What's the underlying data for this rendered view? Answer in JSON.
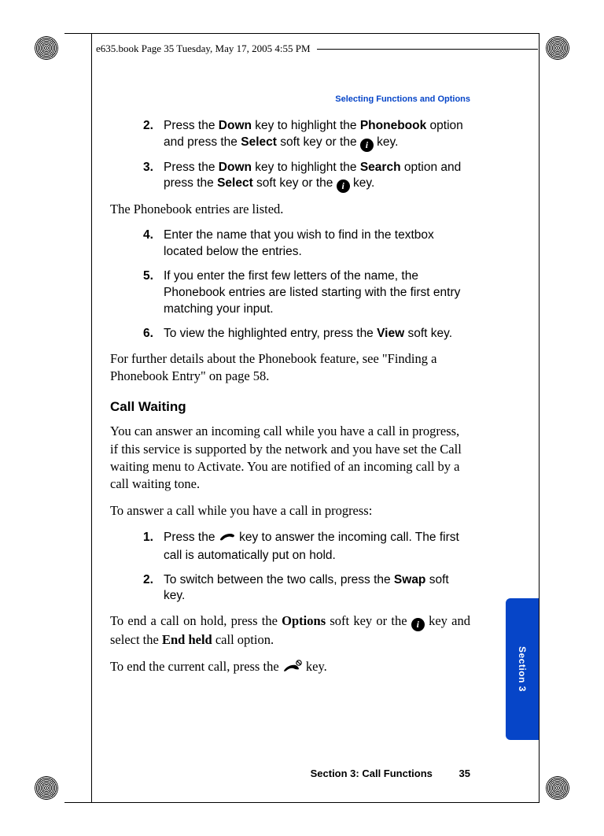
{
  "header": {
    "running": "e635.book  Page 35  Tuesday, May 17, 2005  4:55 PM"
  },
  "section_label": "Selecting Functions and Options",
  "steps_a": {
    "s2_num": "2.",
    "s2_a": "Press the ",
    "s2_b": "Down",
    "s2_c": " key to highlight the ",
    "s2_d": "Phonebook",
    "s2_e": " option and press the ",
    "s2_f": "Select",
    "s2_g": " soft key or the ",
    "s2_h": " key.",
    "s3_num": "3.",
    "s3_a": "Press the ",
    "s3_b": "Down",
    "s3_c": " key to highlight the ",
    "s3_d": "Search",
    "s3_e": " option and press the ",
    "s3_f": "Select",
    "s3_g": " soft key or the ",
    "s3_h": " key."
  },
  "para1": "The Phonebook entries are listed.",
  "steps_b": {
    "s4_num": "4.",
    "s4": "Enter the name that you wish to find in the textbox located below the entries.",
    "s5_num": "5.",
    "s5": "If you enter the first few letters of the name, the Phonebook entries are listed starting with the first entry matching your input.",
    "s6_num": "6.",
    "s6_a": "To view the highlighted entry, press the ",
    "s6_b": "View",
    "s6_c": " soft key."
  },
  "para2": "For further details about the Phonebook feature, see \"Finding a Phonebook Entry\" on page 58.",
  "heading": "Call Waiting",
  "para3": "You can answer an incoming call while you have a call in progress, if this service is supported by the network and you have set the Call waiting menu  to Activate. You are notified of an incoming call by a call waiting tone.",
  "para4": "To answer a call while you have a call in progress:",
  "steps_c": {
    "s1_num": "1.",
    "s1_a": "Press the ",
    "s1_b": " key to answer the incoming call. The first call is automatically put on hold.",
    "s2_num": "2.",
    "s2_a": "To switch between the two calls, press the ",
    "s2_b": "Swap",
    "s2_c": " soft key."
  },
  "para5_a": "To end a call on hold, press the ",
  "para5_b": "Options",
  "para5_c": " soft key or the ",
  "para5_d": " key and select the ",
  "para5_e": "End held",
  "para5_f": " call option.",
  "para6_a": "To end the current call, press the ",
  "para6_b": " key.",
  "side_tab": "Section 3",
  "footer": {
    "title": "Section 3: Call Functions",
    "page": "35"
  },
  "icons": {
    "info": "i"
  }
}
